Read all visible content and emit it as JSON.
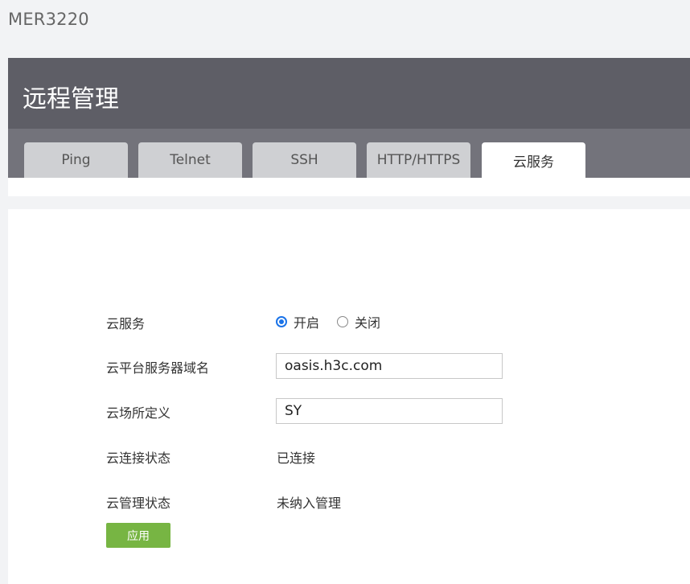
{
  "device": {
    "title": "MER3220"
  },
  "header": {
    "title": "远程管理",
    "tabs": [
      {
        "label": "Ping"
      },
      {
        "label": "Telnet"
      },
      {
        "label": "SSH"
      },
      {
        "label": "HTTP/HTTPS"
      },
      {
        "label": "云服务",
        "active": true
      }
    ]
  },
  "form": {
    "cloud_service": {
      "label": "云服务",
      "options": [
        {
          "label": "开启",
          "checked": true
        },
        {
          "label": "关闭",
          "checked": false
        }
      ]
    },
    "server_domain": {
      "label": "云平台服务器域名",
      "value": "oasis.h3c.com"
    },
    "site_definition": {
      "label": "云场所定义",
      "value": "SY"
    },
    "connection_status": {
      "label": "云连接状态",
      "value": "已连接"
    },
    "management_status": {
      "label": "云管理状态",
      "value": "未纳入管理"
    },
    "apply_label": "应用"
  },
  "colors": {
    "accent": "#1a73e8",
    "apply_button": "#77b543",
    "header_bg": "#5e5e66"
  }
}
